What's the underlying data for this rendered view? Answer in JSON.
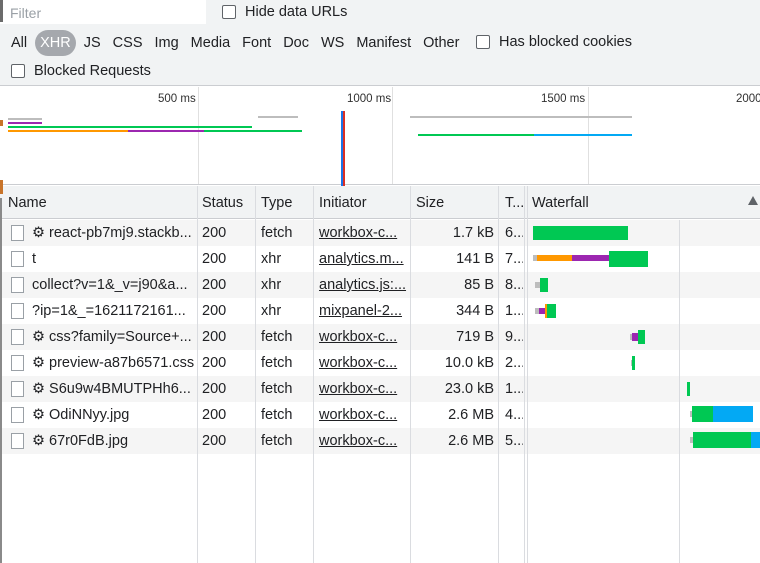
{
  "filter": {
    "placeholder": "Filter"
  },
  "toolbar": {
    "hide_data_urls": "Hide data URLs",
    "has_blocked_cookies": "Has blocked cookies",
    "blocked_requests": "Blocked Requests",
    "types": [
      "All",
      "XHR",
      "JS",
      "CSS",
      "Img",
      "Media",
      "Font",
      "Doc",
      "WS",
      "Manifest",
      "Other"
    ],
    "active_type": "XHR"
  },
  "overview": {
    "tick_labels": [
      "500 ms",
      "1000 ms",
      "1500 ms",
      "2000"
    ]
  },
  "table": {
    "columns": [
      "Name",
      "Status",
      "Type",
      "Initiator",
      "Size",
      "T...",
      "Waterfall"
    ],
    "rows": [
      {
        "name": "⚙ react-pb7mj9.stackb...",
        "status": "200",
        "type": "fetch",
        "initiator": "workbox-c...",
        "size": "1.7 kB",
        "time": "6..."
      },
      {
        "name": "t",
        "status": "200",
        "type": "xhr",
        "initiator": "analytics.m...",
        "size": "141 B",
        "time": "7..."
      },
      {
        "name": "collect?v=1&_v=j90&a...",
        "status": "200",
        "type": "xhr",
        "initiator": "analytics.js:...",
        "size": "85 B",
        "time": "8..."
      },
      {
        "name": "?ip=1&_=1621172161...",
        "status": "200",
        "type": "xhr",
        "initiator": "mixpanel-2...",
        "size": "344 B",
        "time": "1..."
      },
      {
        "name": "⚙ css?family=Source+...",
        "status": "200",
        "type": "fetch",
        "initiator": "workbox-c...",
        "size": "719 B",
        "time": "9..."
      },
      {
        "name": "⚙ preview-a87b6571.css",
        "status": "200",
        "type": "fetch",
        "initiator": "workbox-c...",
        "size": "10.0 kB",
        "time": "2..."
      },
      {
        "name": "⚙ S6u9w4BMUTPHh6...",
        "status": "200",
        "type": "fetch",
        "initiator": "workbox-c...",
        "size": "23.0 kB",
        "time": "1..."
      },
      {
        "name": "⚙ OdiNNyy.jpg",
        "status": "200",
        "type": "fetch",
        "initiator": "workbox-c...",
        "size": "2.6 MB",
        "time": "4..."
      },
      {
        "name": "⚙ 67r0FdB.jpg",
        "status": "200",
        "type": "fetch",
        "initiator": "workbox-c...",
        "size": "2.6 MB",
        "time": "5..."
      }
    ]
  },
  "colors": {
    "waiting": "#00c853",
    "queueing": "#ff9800",
    "stalled": "#9c27b0",
    "download": "#03a9f4",
    "idle": "#bdbdbd"
  }
}
